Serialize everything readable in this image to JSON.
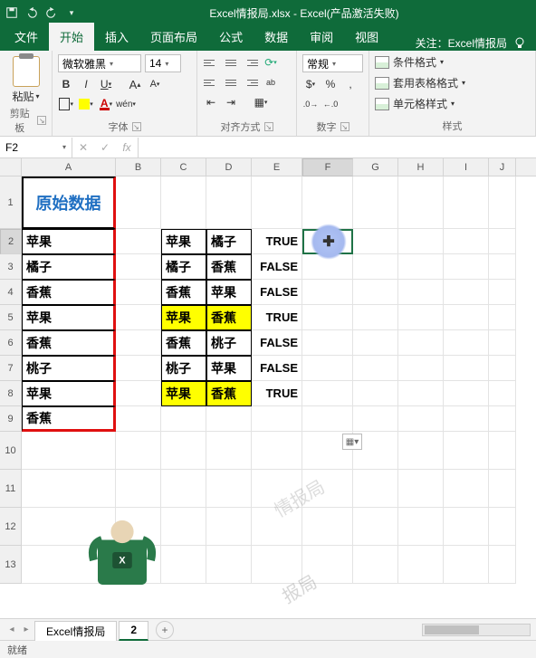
{
  "titlebar": {
    "title": "Excel情报局.xlsx - Excel(产品激活失败)"
  },
  "tabs": {
    "file": "文件",
    "home": "开始",
    "insert": "插入",
    "layout": "页面布局",
    "formula": "公式",
    "data": "数据",
    "review": "审阅",
    "view": "视图",
    "follow": "关注：Excel情报局"
  },
  "ribbon": {
    "clipboard": {
      "paste": "粘贴",
      "label": "剪贴板"
    },
    "font": {
      "name": "微软雅黑",
      "size": "14",
      "label": "字体",
      "wen": "wén"
    },
    "align": {
      "label": "对齐方式",
      "ab": "ab",
      "wrap_icon": "⇄"
    },
    "number": {
      "format": "常规",
      "label": "数字"
    },
    "styles": {
      "cond": "条件格式",
      "table": "套用表格格式",
      "cell": "单元格样式",
      "label": "样式"
    }
  },
  "formula_bar": {
    "name": "F2",
    "fx": "fx",
    "value": ""
  },
  "columns": [
    "A",
    "B",
    "C",
    "D",
    "E",
    "F",
    "G",
    "H",
    "I",
    "J"
  ],
  "row_numbers": [
    "1",
    "2",
    "3",
    "4",
    "5",
    "6",
    "7",
    "8",
    "9",
    "10",
    "11",
    "12",
    "13"
  ],
  "header_text": "原始数据",
  "colA": [
    "苹果",
    "橘子",
    "香蕉",
    "苹果",
    "香蕉",
    "桃子",
    "苹果",
    "香蕉"
  ],
  "colC": [
    "苹果",
    "橘子",
    "香蕉",
    "苹果",
    "香蕉",
    "桃子",
    "苹果"
  ],
  "colD": [
    "橘子",
    "香蕉",
    "苹果",
    "香蕉",
    "桃子",
    "苹果",
    "香蕉"
  ],
  "colE": [
    "TRUE",
    "FALSE",
    "FALSE",
    "TRUE",
    "FALSE",
    "FALSE",
    "TRUE"
  ],
  "yellow_rows": [
    4,
    7
  ],
  "yellow_row_8_D_only": true,
  "sheets": {
    "s1": "Excel情报局",
    "s2": "2"
  },
  "status": "就绪",
  "watermark": "情报局",
  "watermark2": "报局"
}
